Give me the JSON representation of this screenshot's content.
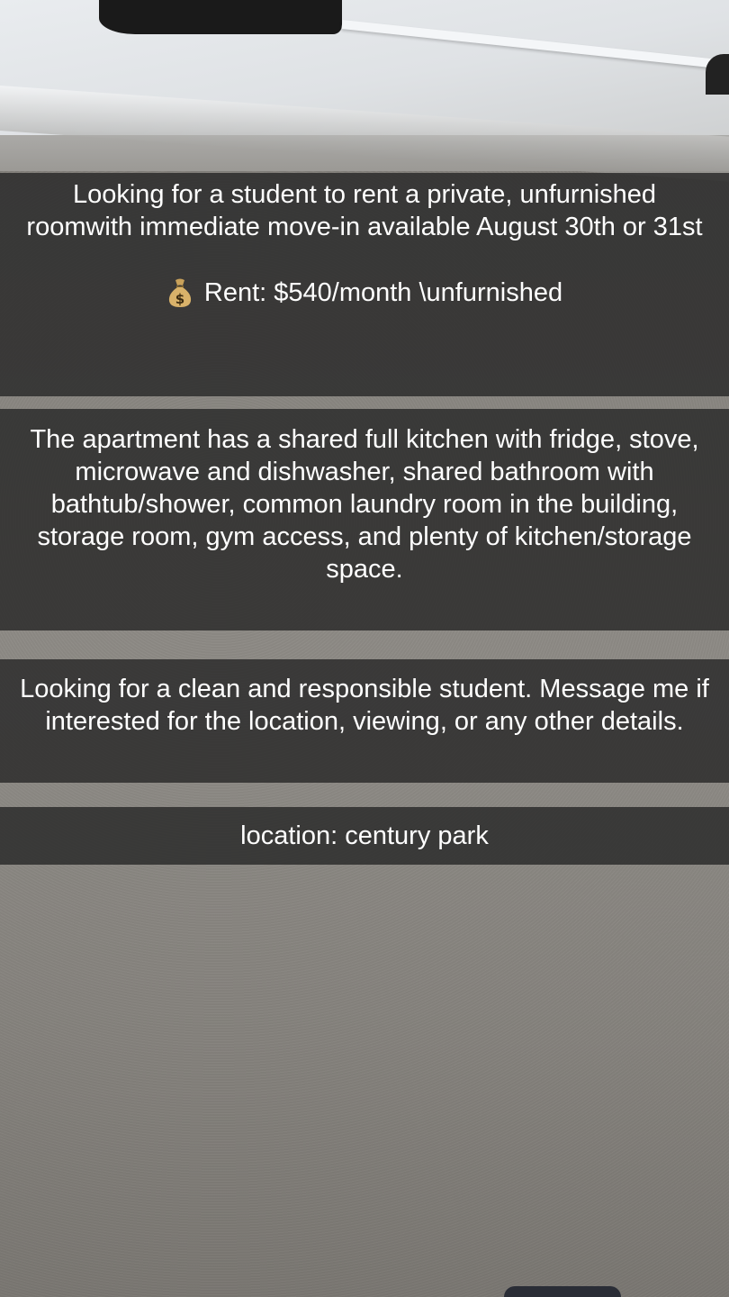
{
  "captions": [
    {
      "text": "Looking for a student to rent a private, unfurnished roomwith immediate move-in available August 30th or 31st",
      "rent_icon": "money-bag-icon",
      "rent_text": "Rent: $540/month \\unfurnished"
    },
    {
      "text": "The apartment has a shared full kitchen with fridge, stove, microwave and dishwasher, shared bathroom with bathtub/shower, common laundry room in the building, storage room, gym access, and plenty of kitchen/storage space."
    },
    {
      "text": "Looking for a clean and responsible student. Message me if interested for the location, viewing, or any other details."
    },
    {
      "text": "location: century park"
    }
  ],
  "colors": {
    "caption_bg": "#282828",
    "caption_text": "#ffffff",
    "wall": "#8b8883"
  }
}
